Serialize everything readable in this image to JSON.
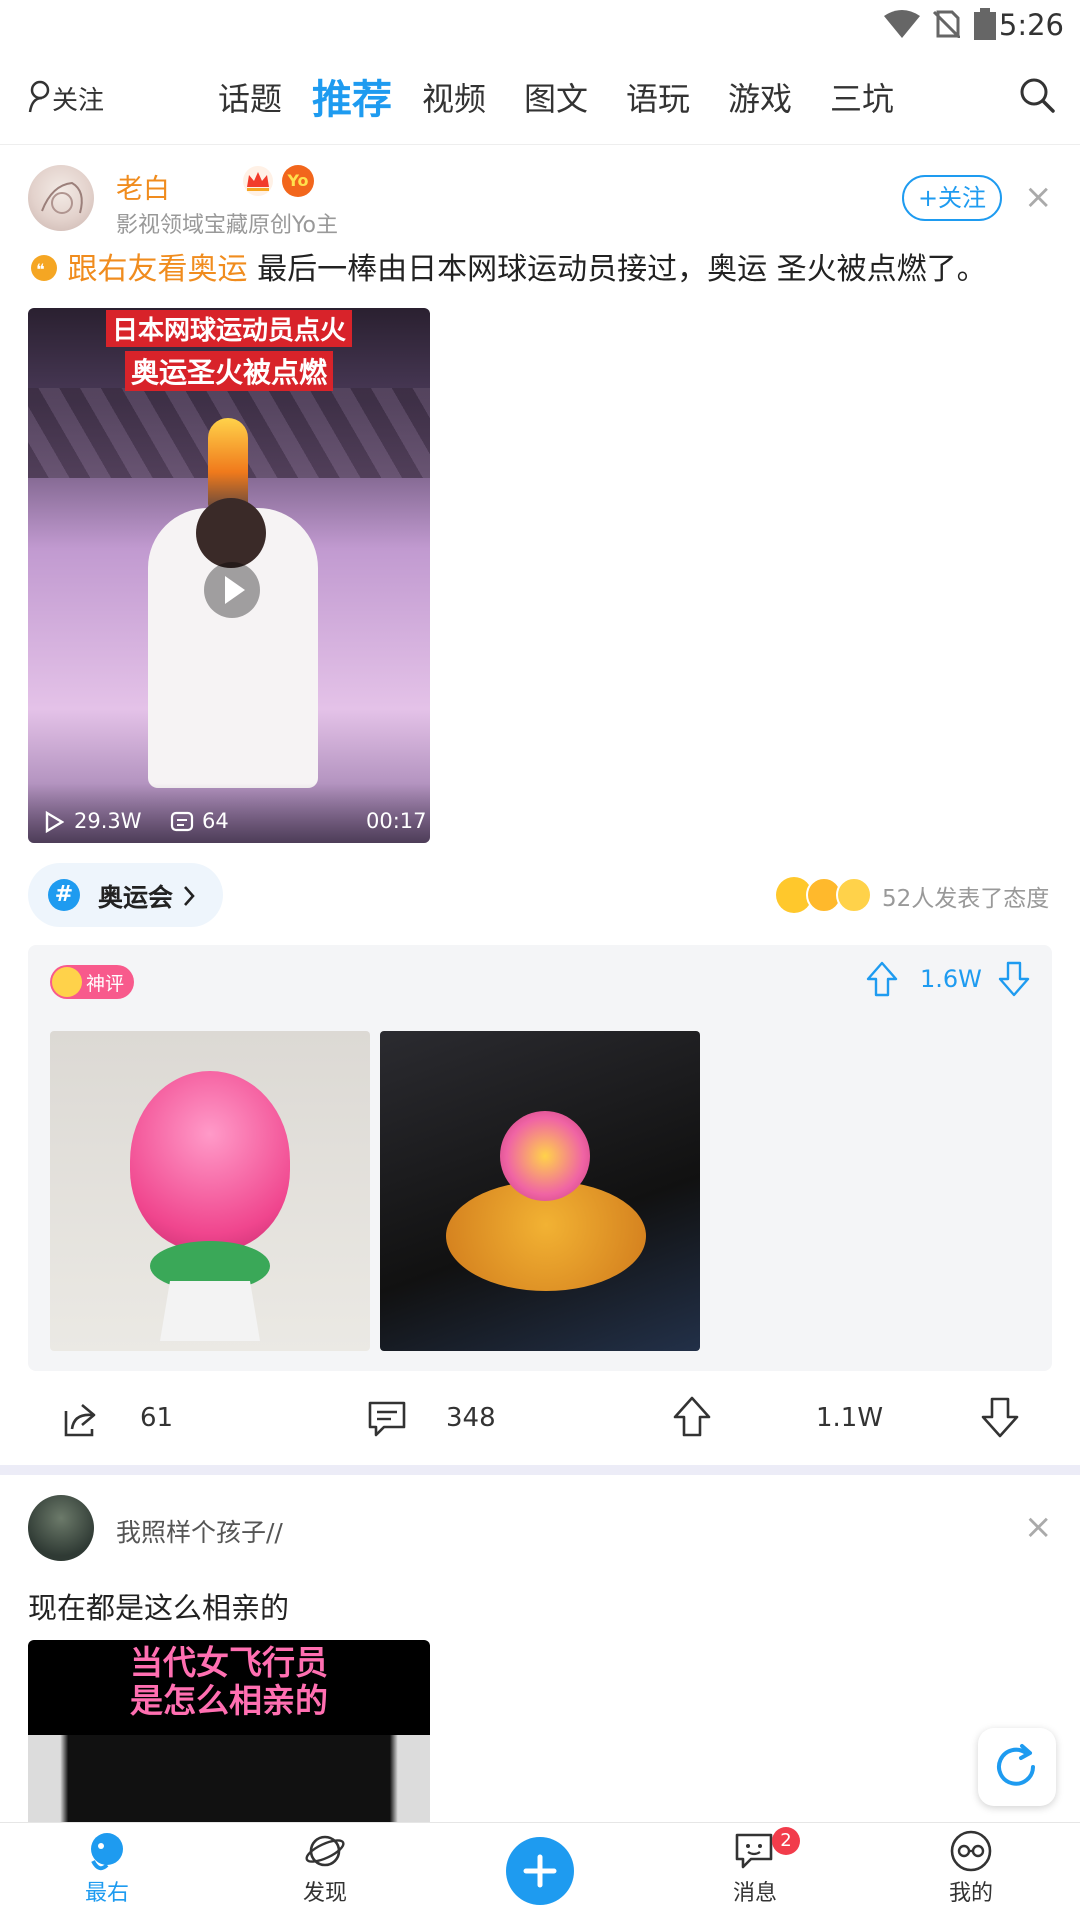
{
  "status_bar": {
    "time": "5:26"
  },
  "top_nav": {
    "follow_label": "关注",
    "tabs": [
      "话题",
      "推荐",
      "视频",
      "图文",
      "语玩",
      "游戏",
      "三坑"
    ],
    "active_tab": "推荐"
  },
  "post1": {
    "username": "老白",
    "user_subtitle": "影视领域宝藏原创Yo主",
    "yo_badge": "Yo",
    "follow_button": "+关注",
    "topic_tag": "跟右友看奥运",
    "text": "最后一棒由日本网球运动员接过，奥运 圣火被点燃了。",
    "video": {
      "overlay_line1": "日本网球运动员点火",
      "overlay_line2": "奥运圣火被点燃",
      "plays": "29.3W",
      "comments": "64",
      "duration": "00:17"
    },
    "hashtag": "奥运会",
    "attitude_text": "52人发表了态度",
    "god_comment": {
      "badge": "神评",
      "score": "1.6W"
    },
    "actions": {
      "shares": "61",
      "comments": "348",
      "upvotes": "1.1W"
    }
  },
  "post2": {
    "username": "我照样个孩子//",
    "text": "现在都是这么相亲的",
    "video": {
      "overlay_line1": "当代女飞行员",
      "overlay_line2": "是怎么相亲的"
    }
  },
  "bottom_bar": {
    "items": [
      "最右",
      "发现",
      "消息",
      "我的"
    ],
    "message_badge": "2",
    "active": "最右"
  },
  "colors": {
    "accent": "#1e9bf0",
    "orange": "#f08c1e",
    "badge_red": "#f23c4b"
  }
}
